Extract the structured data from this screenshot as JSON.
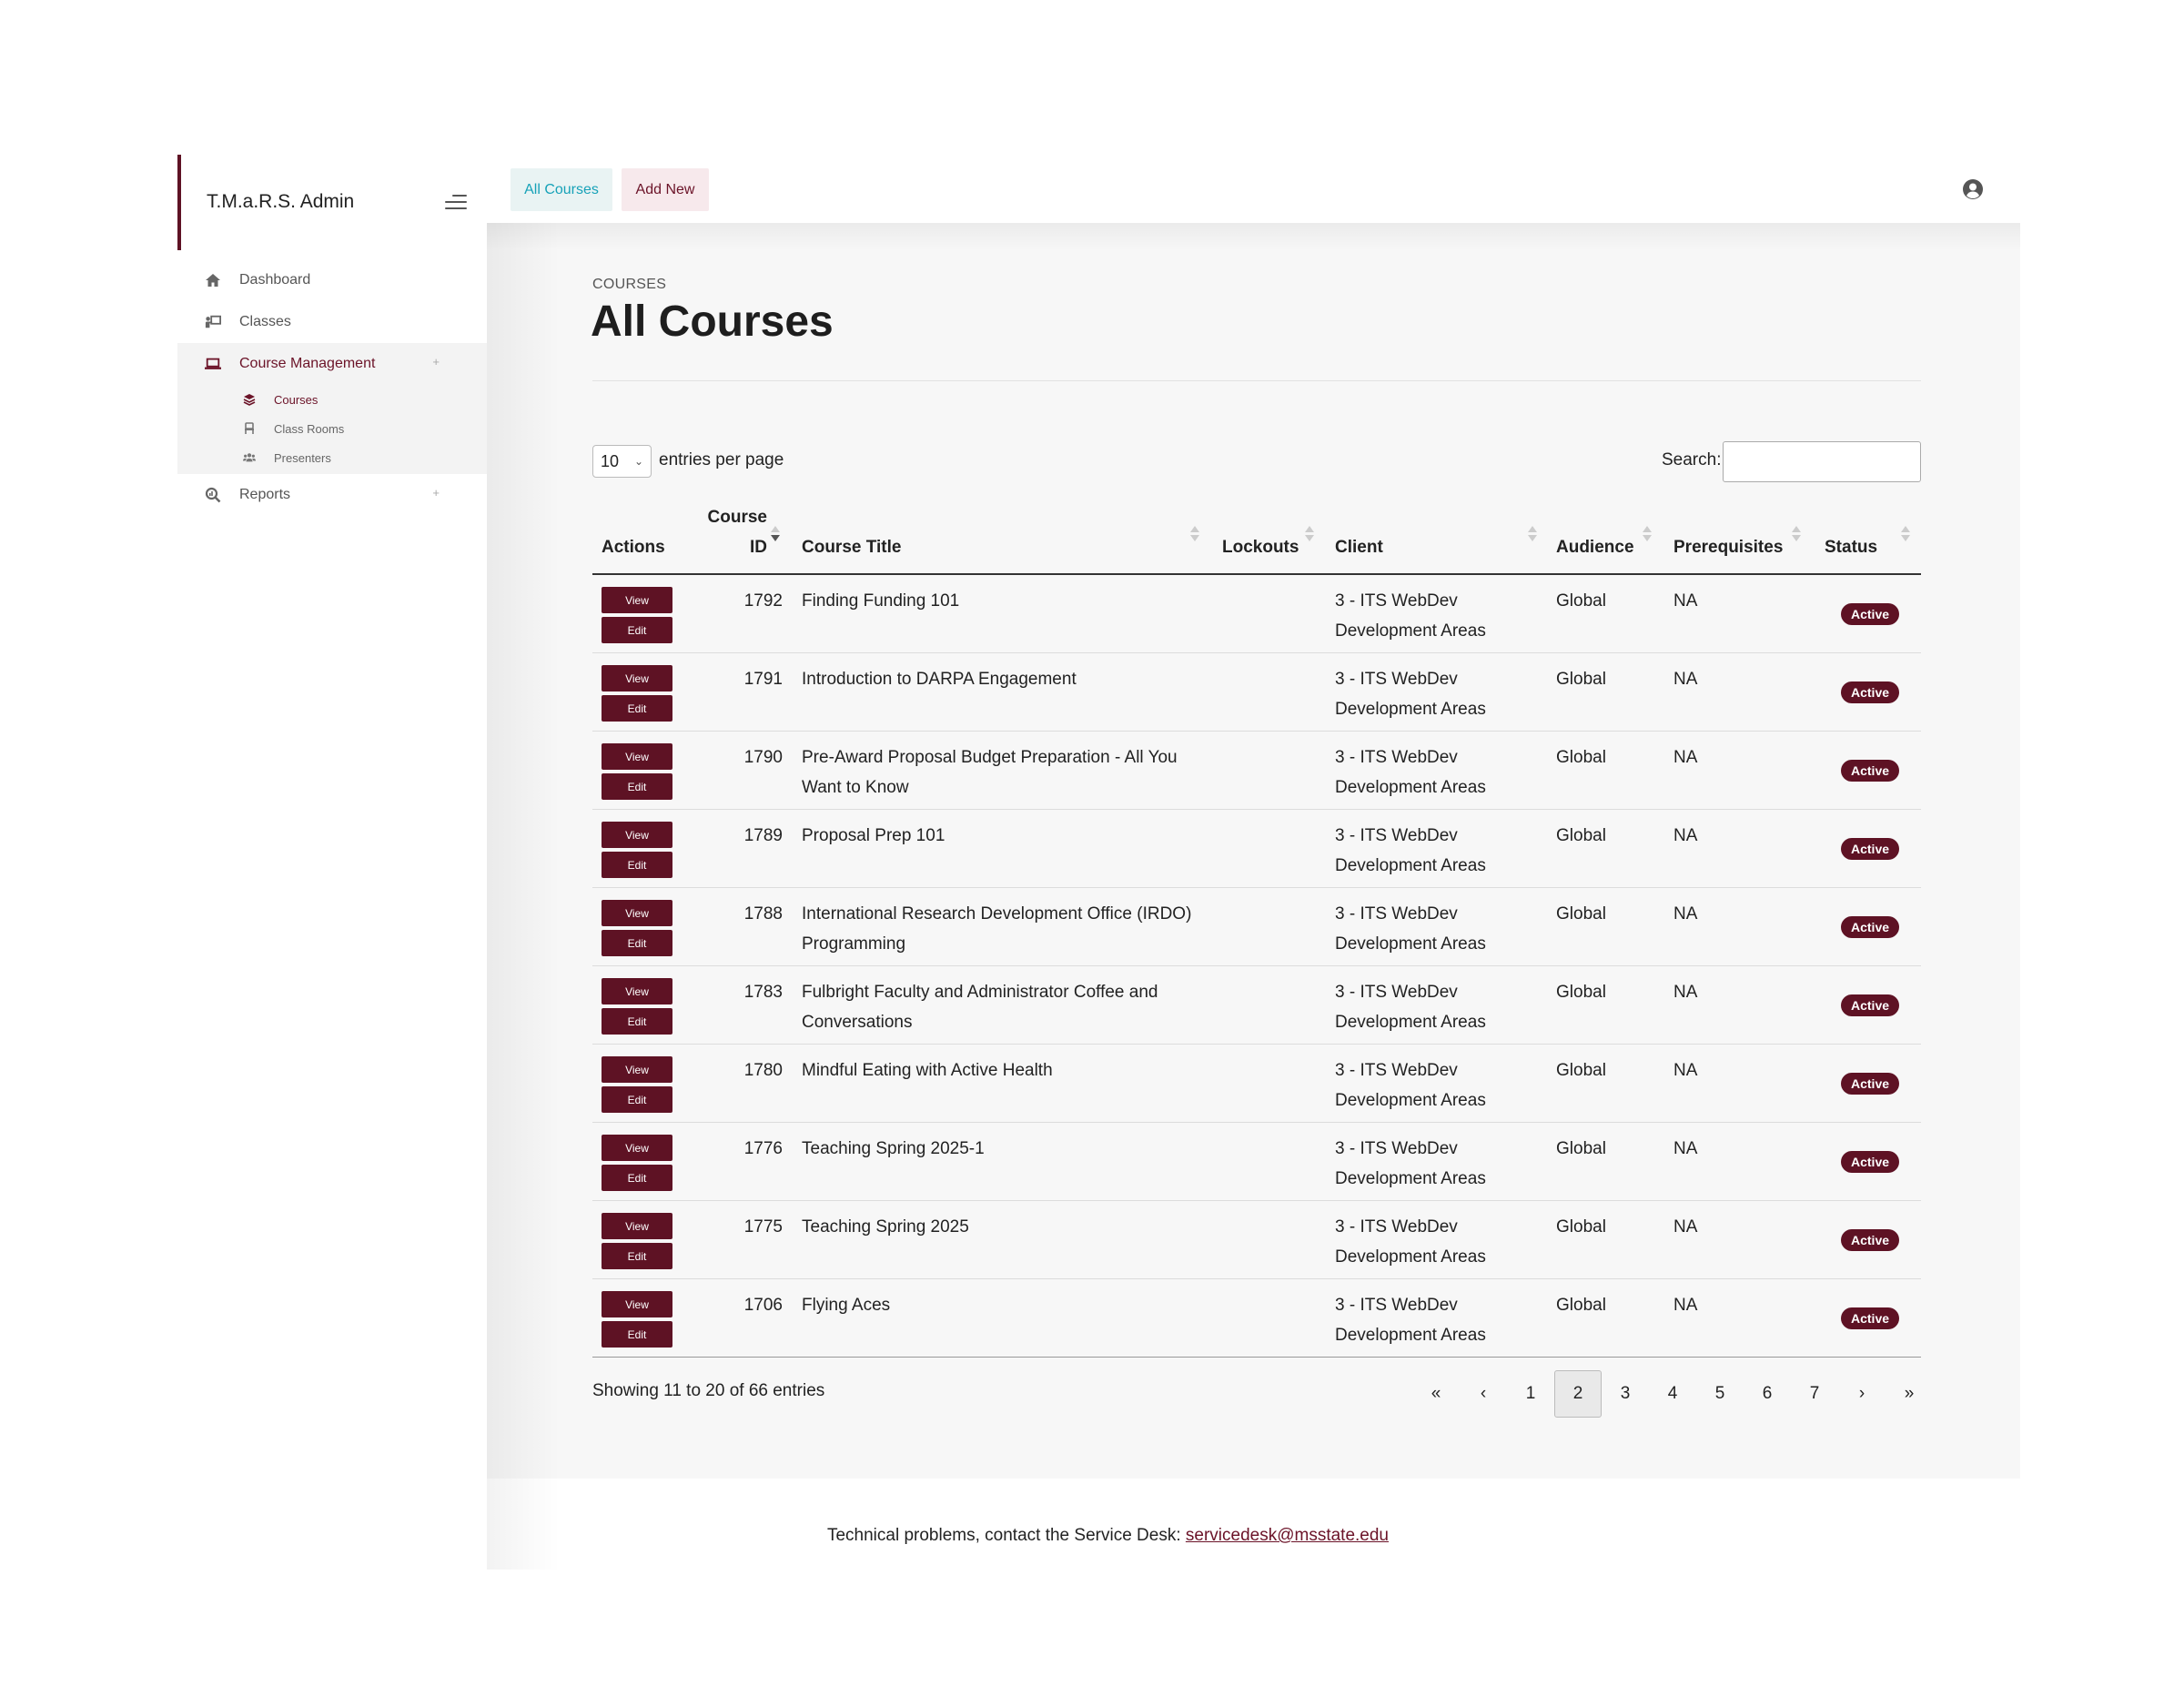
{
  "app": {
    "brand": "T.M.a.R.S. Admin"
  },
  "sidebar": {
    "items": [
      {
        "label": "Dashboard",
        "icon": "home-icon"
      },
      {
        "label": "Classes",
        "icon": "chalkboard-teacher-icon"
      },
      {
        "label": "Course Management",
        "icon": "laptop-icon",
        "active": true,
        "expander": "+"
      },
      {
        "label": "Reports",
        "icon": "search-chart-icon",
        "expander": "+"
      }
    ],
    "subitems": [
      {
        "label": "Courses",
        "icon": "layers-icon",
        "active": true
      },
      {
        "label": "Class Rooms",
        "icon": "chair-icon"
      },
      {
        "label": "Presenters",
        "icon": "users-icon"
      }
    ]
  },
  "topbar": {
    "tab_all": "All Courses",
    "tab_add": "Add New"
  },
  "page": {
    "crumb": "COURSES",
    "title": "All Courses"
  },
  "controls": {
    "entries_value": "10",
    "entries_label": "entries per page",
    "search_label": "Search:",
    "search_value": ""
  },
  "table": {
    "columns": {
      "actions": "Actions",
      "course_id_1": "Course",
      "course_id_2": "ID",
      "title": "Course Title",
      "lockouts": "Lockouts",
      "client": "Client",
      "audience": "Audience",
      "prereq": "Prerequisites",
      "status": "Status"
    },
    "view_label": "View",
    "edit_label": "Edit",
    "rows": [
      {
        "id": "1792",
        "title": "Finding Funding 101",
        "lockouts": "",
        "client": "3 - ITS WebDev Development Areas",
        "audience": "Global",
        "prereq": "NA",
        "status": "Active"
      },
      {
        "id": "1791",
        "title": "Introduction to DARPA Engagement",
        "lockouts": "",
        "client": "3 - ITS WebDev Development Areas",
        "audience": "Global",
        "prereq": "NA",
        "status": "Active"
      },
      {
        "id": "1790",
        "title": "Pre-Award Proposal Budget Preparation - All You Want to Know",
        "lockouts": "",
        "client": "3 - ITS WebDev Development Areas",
        "audience": "Global",
        "prereq": "NA",
        "status": "Active"
      },
      {
        "id": "1789",
        "title": "Proposal Prep 101",
        "lockouts": "",
        "client": "3 - ITS WebDev Development Areas",
        "audience": "Global",
        "prereq": "NA",
        "status": "Active"
      },
      {
        "id": "1788",
        "title": "International Research Development Office (IRDO) Programming",
        "lockouts": "",
        "client": "3 - ITS WebDev Development Areas",
        "audience": "Global",
        "prereq": "NA",
        "status": "Active"
      },
      {
        "id": "1783",
        "title": "Fulbright Faculty and Administrator Coffee and Conversations",
        "lockouts": "",
        "client": "3 - ITS WebDev Development Areas",
        "audience": "Global",
        "prereq": "NA",
        "status": "Active"
      },
      {
        "id": "1780",
        "title": "Mindful Eating with Active Health",
        "lockouts": "",
        "client": "3 - ITS WebDev Development Areas",
        "audience": "Global",
        "prereq": "NA",
        "status": "Active"
      },
      {
        "id": "1776",
        "title": "Teaching Spring 2025-1",
        "lockouts": "",
        "client": "3 - ITS WebDev Development Areas",
        "audience": "Global",
        "prereq": "NA",
        "status": "Active"
      },
      {
        "id": "1775",
        "title": "Teaching Spring 2025",
        "lockouts": "",
        "client": "3 - ITS WebDev Development Areas",
        "audience": "Global",
        "prereq": "NA",
        "status": "Active"
      },
      {
        "id": "1706",
        "title": "Flying Aces",
        "lockouts": "",
        "client": "3 - ITS WebDev Development Areas",
        "audience": "Global",
        "prereq": "NA",
        "status": "Active"
      }
    ]
  },
  "pagination": {
    "info": "Showing 11 to 20 of 66 entries",
    "first": "«",
    "prev": "‹",
    "pages": [
      "1",
      "2",
      "3",
      "4",
      "5",
      "6",
      "7"
    ],
    "current": "2",
    "next": "›",
    "last": "»"
  },
  "footer": {
    "text": "Technical problems, contact the Service Desk: ",
    "link": "servicedesk@msstate.edu"
  },
  "colors": {
    "brand": "#5e1224",
    "accent": "#17a2b8",
    "active_nav": "#6b1328"
  }
}
